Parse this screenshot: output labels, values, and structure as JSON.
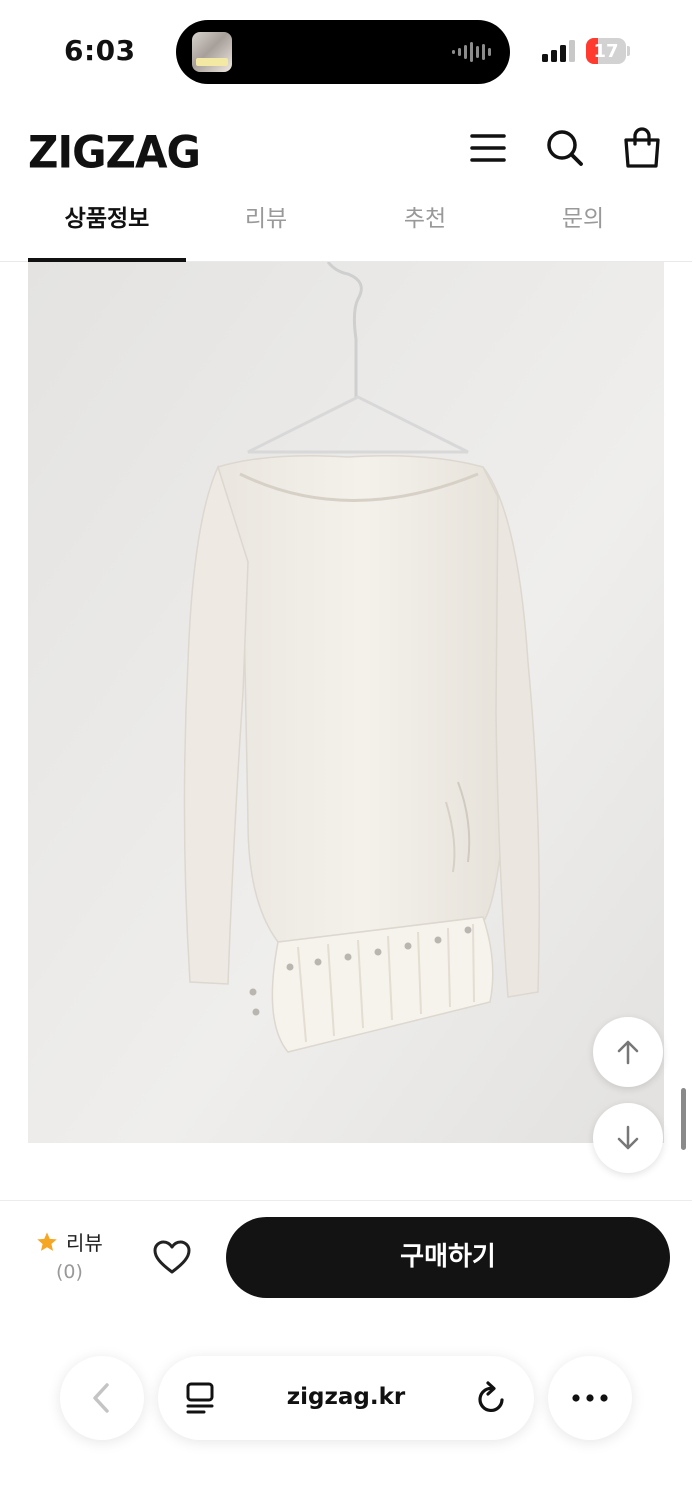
{
  "status_bar": {
    "time": "6:03",
    "battery_level": "17",
    "battery_color": "#ff3b30"
  },
  "header": {
    "logo": "ZIGZAG",
    "icons": [
      "menu-icon",
      "search-icon",
      "shopping-bag-icon"
    ]
  },
  "tabs": [
    {
      "label": "상품정보",
      "active": true
    },
    {
      "label": "리뷰",
      "active": false
    },
    {
      "label": "추천",
      "active": false
    },
    {
      "label": "문의",
      "active": false
    }
  ],
  "product": {
    "image_subject": "cream long-sleeve top on hanger"
  },
  "action_bar": {
    "review_label": "리뷰",
    "review_count": "(0)",
    "buy_label": "구매하기",
    "star_color": "#f5a623",
    "buy_color": "#131313"
  },
  "browser": {
    "url": "zigzag.kr"
  }
}
